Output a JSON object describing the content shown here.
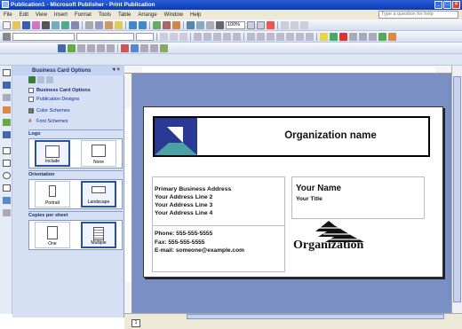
{
  "window": {
    "title": "Publication1 - Microsoft Publisher - Print Publication",
    "controls": [
      "_",
      "□",
      "×"
    ]
  },
  "menu": {
    "items": [
      "File",
      "Edit",
      "View",
      "Insert",
      "Format",
      "Tools",
      "Table",
      "Arrange",
      "Window",
      "Help"
    ],
    "help_placeholder": "Type a question for help"
  },
  "toolbar": {
    "zoom": "100%"
  },
  "taskpane": {
    "title": "Business Card Options",
    "controls": "▾ ×",
    "links": [
      {
        "label": "Business Card Options",
        "icon": "card-options-icon"
      },
      {
        "label": "Publication Designs",
        "icon": "designs-icon"
      },
      {
        "label": "Color Schemes",
        "icon": "color-schemes-icon"
      },
      {
        "label": "Font Schemes",
        "icon": "font-schemes-icon"
      }
    ],
    "logo": {
      "heading": "Logo",
      "options": [
        "Include",
        "None"
      ],
      "selected": "Include"
    },
    "orientation": {
      "heading": "Orientation",
      "options": [
        "Portrait",
        "Landscape"
      ],
      "selected": "Landscape"
    },
    "copies": {
      "heading": "Copies per sheet",
      "options": [
        "One",
        "Multiple"
      ],
      "selected": "Multiple"
    }
  },
  "card": {
    "org_name": "Organization name",
    "address": [
      "Primary Business Address",
      "Your Address Line 2",
      "Your Address Line 3",
      "Your Address Line 4"
    ],
    "phone": "Phone: 555-555-5555",
    "fax": "Fax: 555-555-5555",
    "email": "E-mail: someone@example.com",
    "name": "Your Name",
    "title": "Your Title",
    "logo_text": "Organization"
  },
  "status": {
    "page": "1"
  },
  "colors": {
    "titlebar": "#0a3ab6",
    "workspace": "#7a8fc4",
    "taskpane": "#d6e0f5",
    "logo_navy": "#2a3a94",
    "logo_teal": "#4aa1a6"
  }
}
